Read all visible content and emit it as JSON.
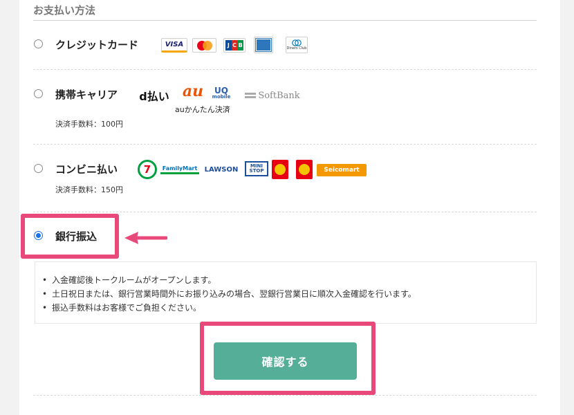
{
  "section": {
    "title": "お支払い方法"
  },
  "options": {
    "credit": {
      "label": "クレジットカード"
    },
    "carrier": {
      "label": "携帯キャリア",
      "fee": "決済手数料：100円"
    },
    "convenience": {
      "label": "コンビニ払い",
      "fee": "決済手数料：150円"
    },
    "bank": {
      "label": "銀行振込",
      "checked": true
    }
  },
  "logos": {
    "visa": "VISA",
    "jcb": "JCB",
    "diners": "Diners Club",
    "dpay": "d払い",
    "au": "au",
    "uq_top": "UQ",
    "uq_bottom": "mobile",
    "au_caption": "auかんたん決済",
    "softbank": "SoftBank",
    "seven": "7",
    "familymart": "FamilyMart",
    "lawson": "LAWSON",
    "ministop": "MINI STOP",
    "seicomart": "Seicomart"
  },
  "bank_info": {
    "items": [
      "入金確認後トークルームがオープンします。",
      "土日祝日または、銀行営業時間外にお振り込みの場合、翌銀行営業日に順次入金確認を行います。",
      "振込手数料はお客様でご負担ください。"
    ]
  },
  "confirm": {
    "label": "確認する"
  },
  "colors": {
    "accent_pink": "#e8497a",
    "button_green": "#55ae98",
    "radio_blue": "#1a73e8"
  }
}
